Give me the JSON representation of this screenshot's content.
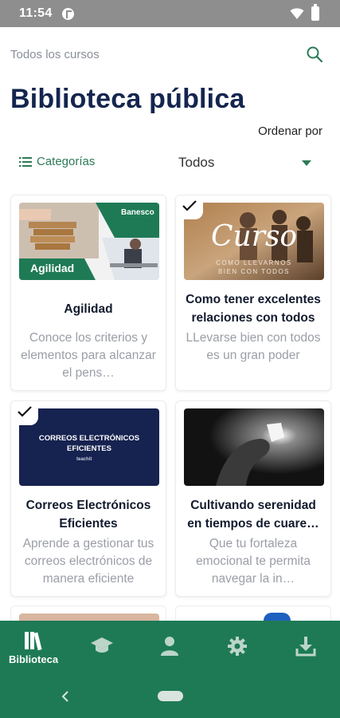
{
  "status": {
    "time": "11:54",
    "app_icon": "pocket-casts-icon",
    "wifi_icon": "wifi-icon",
    "battery_icon": "battery-icon"
  },
  "topbar": {
    "title": "Todos los cursos",
    "search_icon": "search-icon"
  },
  "page": {
    "title": "Biblioteca pública",
    "sort_label": "Ordenar por"
  },
  "filters": {
    "category_label": "Categorías",
    "category_icon": "list-icon",
    "selected": "Todos"
  },
  "courses": [
    {
      "title": "Agilidad",
      "description": "Conoce los criterios y elementos para alcanzar el pens…",
      "completed": false,
      "image_text": "Agilidad",
      "image_logo": "Banesco"
    },
    {
      "title": "Como tener excelentes relaciones con todos",
      "description": "LLevarse bien con todos es un gran poder",
      "completed": true,
      "image_text": "Curso",
      "image_subtext": "COMO LLEVARNOS BIEN CON TODOS"
    },
    {
      "title": "Correos Electrónicos Eficientes",
      "description": "Aprende a gestionar tus correos electrónicos de manera eficiente",
      "completed": true,
      "image_text": "CORREOS ELECTRÓNICOS EFICIENTES",
      "image_subtext": "teachit"
    },
    {
      "title": "Cultivando serenidad en tiempos de cuare…",
      "description": "Que tu fortaleza emocional te permita navegar la in…",
      "completed": false
    }
  ],
  "bottom_nav": {
    "items": [
      {
        "label": "Biblioteca",
        "icon": "library-icon",
        "active": true
      },
      {
        "label": "",
        "icon": "graduation-cap-icon",
        "active": false
      },
      {
        "label": "",
        "icon": "person-icon",
        "active": false
      },
      {
        "label": "",
        "icon": "gear-icon",
        "active": false
      },
      {
        "label": "",
        "icon": "download-icon",
        "active": false
      }
    ]
  },
  "colors": {
    "accent": "#1e7a55",
    "title": "#14254f",
    "muted": "#9a9ea6"
  }
}
